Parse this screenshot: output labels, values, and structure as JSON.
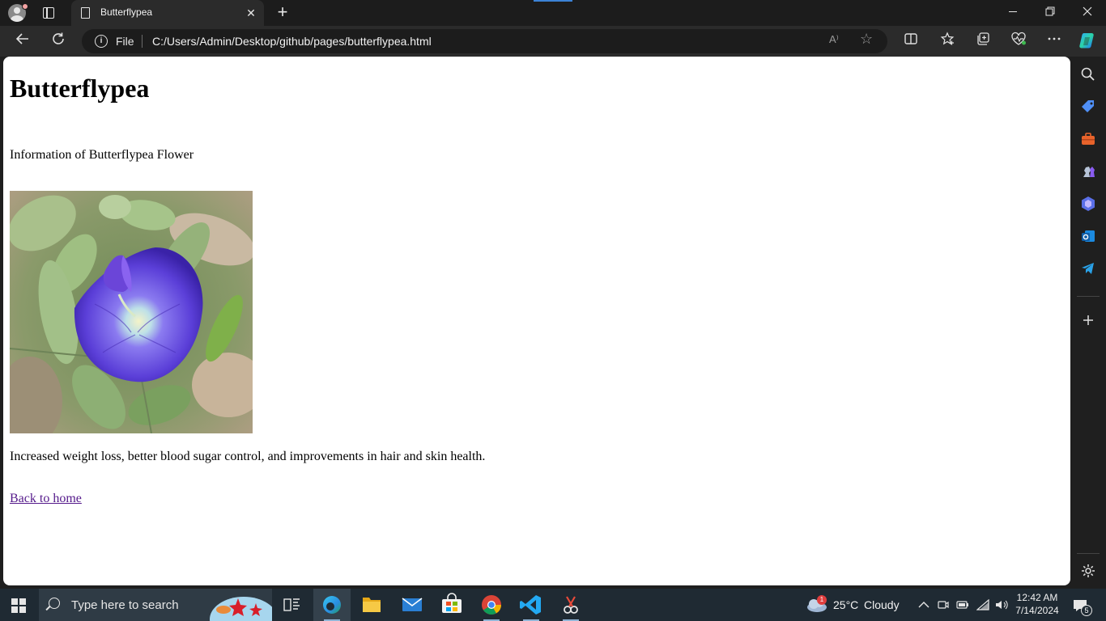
{
  "browser": {
    "tab_title": "Butterflypea",
    "close_tab_glyph": "✕",
    "new_tab_glyph": "+",
    "window_controls": {
      "minimize": "—",
      "restore": "❐",
      "close": "✕"
    },
    "address": {
      "scheme_label": "File",
      "url": "C:/Users/Admin/Desktop/github/pages/butterflypea.html",
      "read_aloud_glyph": "A⁾",
      "favorite_glyph": "☆"
    }
  },
  "page": {
    "heading": "Butterflypea",
    "intro": "Information of Butterflypea Flower",
    "description": "Increased weight loss, better blood sugar control, and improvements in hair and skin health.",
    "link_text": "Back to home"
  },
  "taskbar": {
    "search_placeholder": "Type here to search",
    "weather": {
      "temp": "25°C",
      "condition": "Cloudy",
      "badge": "1"
    },
    "clock": {
      "time": "12:42 AM",
      "date": "7/14/2024"
    },
    "notification_count": "5"
  },
  "colors": {
    "link_visited": "#551a8b",
    "edge_accent": "#3b82d6",
    "taskbar_bg": "#1f2a33"
  }
}
